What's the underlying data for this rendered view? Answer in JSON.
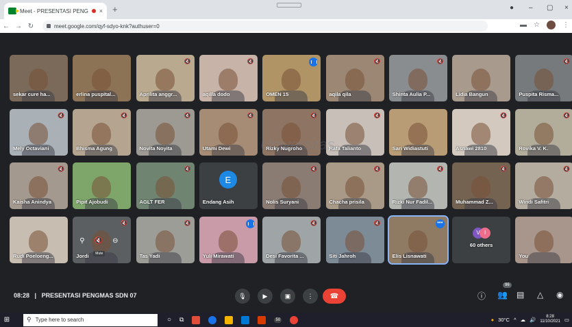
{
  "browser": {
    "tab_title": "Meet - PRESENTASI PENGM...",
    "url": "meet.google.com/qyf-sdyo-knk?authuser=0",
    "close_tab": "×",
    "new_tab": "+"
  },
  "tiles": [
    {
      "name": "sekar cure ha...",
      "muted": false,
      "bg": "#7b6a5a"
    },
    {
      "name": "erlina puspital...",
      "muted": false,
      "bg": "#8d7356"
    },
    {
      "name": "Aprilita anggr...",
      "muted": true,
      "bg": "#b9a98f"
    },
    {
      "name": "aqilla dodo",
      "muted": true,
      "bg": "#c7b3a7"
    },
    {
      "name": "OMEN 15",
      "muted": false,
      "bg": "#b09466",
      "speaking": true
    },
    {
      "name": "aqila qila",
      "muted": true,
      "bg": "#9b8773"
    },
    {
      "name": "Shinta Aulia P...",
      "muted": true,
      "bg": "#8a8d8f"
    },
    {
      "name": "Lidia Bangun",
      "muted": false,
      "bg": "#a89b8e"
    },
    {
      "name": "Puspita Risma...",
      "muted": true,
      "bg": "#777a7c"
    },
    {
      "name": "Mely Octaviani",
      "muted": true,
      "bg": "#aab1b6"
    },
    {
      "name": "Bhisma Agung",
      "muted": true,
      "bg": "#b5a590"
    },
    {
      "name": "Novita Noyita",
      "muted": true,
      "bg": "#9d9a93"
    },
    {
      "name": "Utami Dewi",
      "muted": true,
      "bg": "#a68c74"
    },
    {
      "name": "Rizky Nugroho",
      "muted": true,
      "bg": "#8e7462"
    },
    {
      "name": "Rafa Talianto",
      "muted": true,
      "bg": "#c8c0b8"
    },
    {
      "name": "Sari Widiastuti",
      "muted": false,
      "bg": "#b89c76"
    },
    {
      "name": "Asnawi 2810",
      "muted": true,
      "bg": "#d3c9bf"
    },
    {
      "name": "Rovika V. K.",
      "muted": true,
      "bg": "#b2ad9a"
    },
    {
      "name": "Kaisha Anindya",
      "muted": true,
      "bg": "#a4998e"
    },
    {
      "name": "Pipit Ajobudi",
      "muted": false,
      "bg": "#7ea66a"
    },
    {
      "name": "AGLT FER",
      "muted": true,
      "bg": "#6f8572"
    },
    {
      "name": "Endang Asih",
      "muted": false,
      "bg": "#3c4043",
      "avatar_letter": "E"
    },
    {
      "name": "Nolis Suryani",
      "muted": true,
      "bg": "#8b7c73"
    },
    {
      "name": "Chacha prisila",
      "muted": true,
      "bg": "#a99a87"
    },
    {
      "name": "Rizki Nur Fadil...",
      "muted": true,
      "bg": "#b3b5b0"
    },
    {
      "name": "Muhammad Z...",
      "muted": true,
      "bg": "#756352"
    },
    {
      "name": "Windi Safitri",
      "muted": true,
      "bg": "#b4ac9f"
    },
    {
      "name": "Rudi Poeloeng...",
      "muted": false,
      "bg": "#c7bdb0"
    },
    {
      "name": "Jordi",
      "muted": true,
      "bg": "#5c5f62",
      "hover": true
    },
    {
      "name": "Tas Yadi",
      "muted": true,
      "bg": "#9d9d98"
    },
    {
      "name": "Yuli Mirawati",
      "muted": false,
      "bg": "#c99aa7",
      "speaking": true
    },
    {
      "name": "Desi Favorita ...",
      "muted": true,
      "bg": "#9fa5a7"
    },
    {
      "name": "Siti Jahroh",
      "muted": true,
      "bg": "#7d8b97"
    },
    {
      "name": "Elis Lisnawati",
      "muted": false,
      "bg": "#8f7a64",
      "pinned": true
    },
    {
      "name": "60 others",
      "muted": false,
      "bg": "#3c4043",
      "others": true
    },
    {
      "name": "You",
      "muted": false,
      "bg": "#a8958b"
    }
  ],
  "hover_tip": "Mute",
  "watermark": "Universitas",
  "meeting": {
    "time": "08:28",
    "separator": "|",
    "title": "PRESENTASI PENGMAS SDN 07",
    "participants_badge": "96"
  },
  "others_avatars": [
    "V",
    "I"
  ],
  "taskbar": {
    "search_placeholder": "Type here to search",
    "temperature": "30°C",
    "clock_time": "8:28",
    "clock_date": "11/10/2021",
    "badge_50": "50"
  },
  "colors": {
    "end_call": "#ea4335",
    "accent": "#1a73e8",
    "background": "#202124"
  }
}
